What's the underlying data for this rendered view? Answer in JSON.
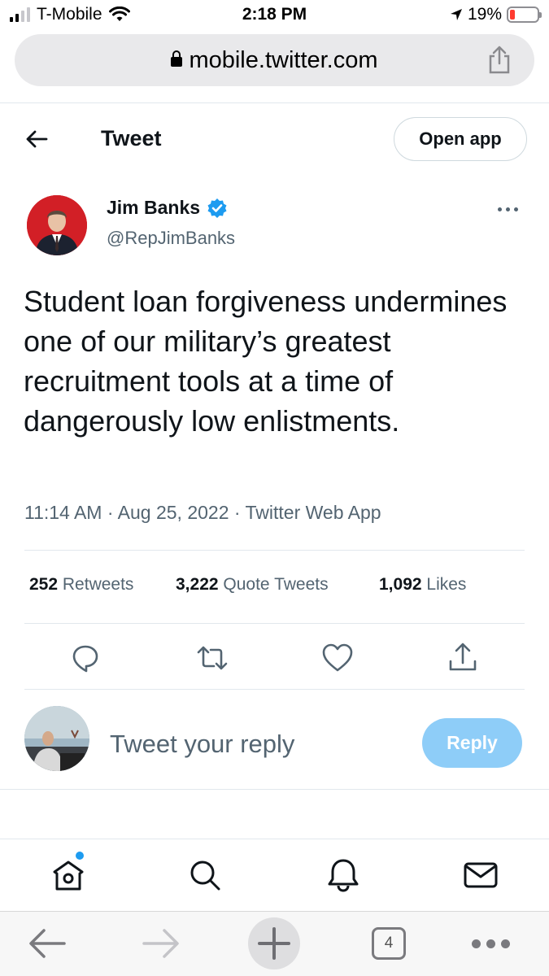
{
  "status_bar": {
    "carrier": "T-Mobile",
    "time": "2:18 PM",
    "battery_percent": "19%",
    "battery_level": 0.19,
    "battery_color": "#ff3b30"
  },
  "browser": {
    "url": "mobile.twitter.com",
    "tab_count": "4"
  },
  "header": {
    "title": "Tweet",
    "open_app_label": "Open app"
  },
  "tweet": {
    "author_name": "Jim Banks",
    "author_handle": "@RepJimBanks",
    "verified": true,
    "text": "Student loan forgiveness undermines one of our military’s greatest recruitment tools at a time of dangerously low enlistments.",
    "timestamp": "11:14 AM · Aug 25, 2022 · Twitter Web App",
    "stats": {
      "retweets_count": "252",
      "retweets_label": "Retweets",
      "quotes_count": "3,222",
      "quotes_label": "Quote Tweets",
      "likes_count": "1,092",
      "likes_label": "Likes"
    }
  },
  "reply": {
    "placeholder": "Tweet your reply",
    "button_label": "Reply"
  },
  "icons": {
    "actions": [
      "reply-icon",
      "retweet-icon",
      "like-icon",
      "share-icon"
    ],
    "bottom_nav": [
      "home-icon",
      "search-icon",
      "notifications-icon",
      "messages-icon"
    ],
    "browser": [
      "back-arrow-icon",
      "forward-arrow-icon",
      "new-tab-icon",
      "tabs-icon",
      "more-icon"
    ]
  },
  "colors": {
    "accent": "#1d9bf0",
    "reply_button_disabled": "#8ecdf8",
    "avatar_background": "#d21f26"
  }
}
